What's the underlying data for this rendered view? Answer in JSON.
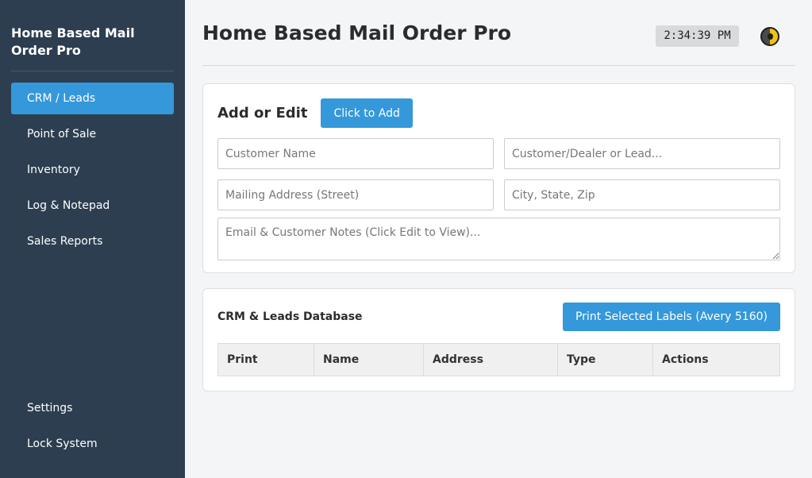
{
  "app": {
    "brand": "Home Based Mail Order Pro"
  },
  "sidebar": {
    "items": [
      {
        "label": "CRM / Leads",
        "active": true
      },
      {
        "label": "Point of Sale"
      },
      {
        "label": "Inventory"
      },
      {
        "label": "Log & Notepad"
      },
      {
        "label": "Sales Reports"
      }
    ],
    "bottom_items": [
      {
        "label": "Settings"
      },
      {
        "label": "Lock System"
      }
    ]
  },
  "header": {
    "title": "Home Based Mail Order Pro",
    "clock": "2:34:39 PM",
    "theme_toggle_icon": "half-moon-theme-icon"
  },
  "form": {
    "title": "Add or Edit",
    "add_button": "Click to Add",
    "fields": {
      "customer_name": {
        "placeholder": "Customer Name",
        "value": ""
      },
      "customer_type": {
        "placeholder": "Customer/Dealer or Lead...",
        "value": ""
      },
      "mailing_address": {
        "placeholder": "Mailing Address (Street)",
        "value": ""
      },
      "city_state_zip": {
        "placeholder": "City, State, Zip",
        "value": ""
      },
      "notes": {
        "placeholder": "Email & Customer Notes (Click Edit to View)...",
        "value": ""
      }
    }
  },
  "database": {
    "title": "CRM & Leads Database",
    "print_button": "Print Selected Labels (Avery 5160)",
    "columns": [
      "Print",
      "Name",
      "Address",
      "Type",
      "Actions"
    ],
    "rows": []
  },
  "colors": {
    "sidebar_bg": "#2c3e50",
    "accent": "#3498db",
    "page_bg": "#f4f5f6"
  }
}
